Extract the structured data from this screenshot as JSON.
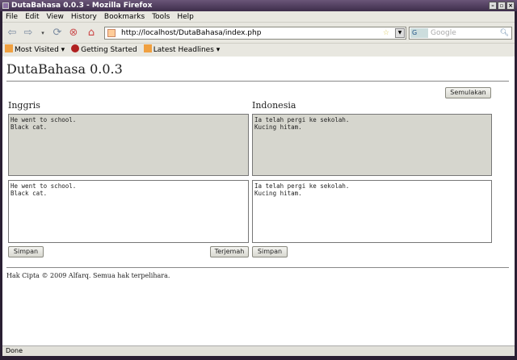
{
  "window": {
    "title": "DutaBahasa 0.0.3 - Mozilla Firefox"
  },
  "menu": [
    "File",
    "Edit",
    "View",
    "History",
    "Bookmarks",
    "Tools",
    "Help"
  ],
  "nav": {
    "url": "http://localhost/DutaBahasa/index.php",
    "search_placeholder": "Google",
    "search_engine": "G"
  },
  "bookmarks": [
    "Most Visited",
    "Getting Started",
    "Latest Headlines"
  ],
  "page": {
    "title": "DutaBahasa 0.0.3",
    "reset_label": "Semulakan",
    "left": {
      "heading": "Inggris",
      "source_text": "He went to school.\nBlack cat.",
      "edit_text": "He went to school.\nBlack cat.",
      "save_label": "Simpan",
      "translate_label": "Terjemah"
    },
    "right": {
      "heading": "Indonesia",
      "source_text": "Ia telah pergi ke sekolah.\nKucing hitam.",
      "edit_text": "Ia telah pergi ke sekolah.\nKucing hitam.",
      "save_label": "Simpan"
    },
    "footer": "Hak Cipta © 2009 Alfarq. Semua hak terpelihara."
  },
  "status": "Done"
}
